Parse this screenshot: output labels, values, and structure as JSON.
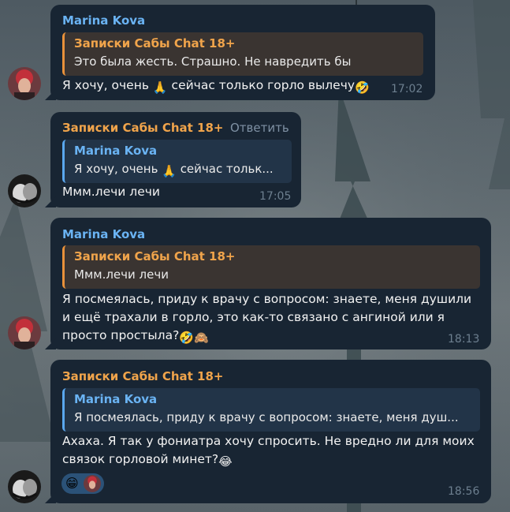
{
  "messages": [
    {
      "sender": "Marina Kova",
      "quote": {
        "name": "Записки Сабы Chat 18+",
        "text": "Это была жесть. Страшно. Не навредить бы"
      },
      "lines": [
        "Я хочу, очень",
        "сейчас только горло вылечу"
      ],
      "emoji": [
        "🙏",
        "🤣"
      ],
      "time": "17:02"
    },
    {
      "sender": "Записки Сабы Chat 18+",
      "reply_label": "Ответить",
      "quote": {
        "name": "Marina Kova",
        "text_a": "Я хочу, очень",
        "text_b": "сейчас тольк..."
      },
      "emoji": [
        "🙏"
      ],
      "lines": [
        "Ммм.лечи лечи"
      ],
      "time": "17:05"
    },
    {
      "sender": "Marina Kova",
      "quote": {
        "name": "Записки Сабы Chat 18+",
        "text": "Ммм.лечи лечи"
      },
      "lines": [
        "Я посмеялась, приду к врачу с вопросом: знаете, меня душили",
        "и ещё трахали в горло, это как-то связано с ангиной или я",
        "просто простыла?"
      ],
      "emoji": [
        "🤣",
        "🙈"
      ],
      "time": "18:13"
    },
    {
      "sender": "Записки Сабы Chat 18+",
      "quote": {
        "name": "Marina Kova",
        "text": "Я посмеялась, приду к врачу с вопросом: знаете, меня душ..."
      },
      "lines": [
        "Ахаха. Я так у  фониатра  хочу  спросить. Не вредно ли для моих",
        "связок горловой минет?"
      ],
      "emoji": [
        "😂"
      ],
      "reaction": {
        "emoji": "😁"
      },
      "time": "18:56"
    }
  ],
  "colors": {
    "bubble": "#182533",
    "name_blue": "#6ab3f3",
    "name_orange": "#f0a44b",
    "time": "#6d7f8f"
  }
}
